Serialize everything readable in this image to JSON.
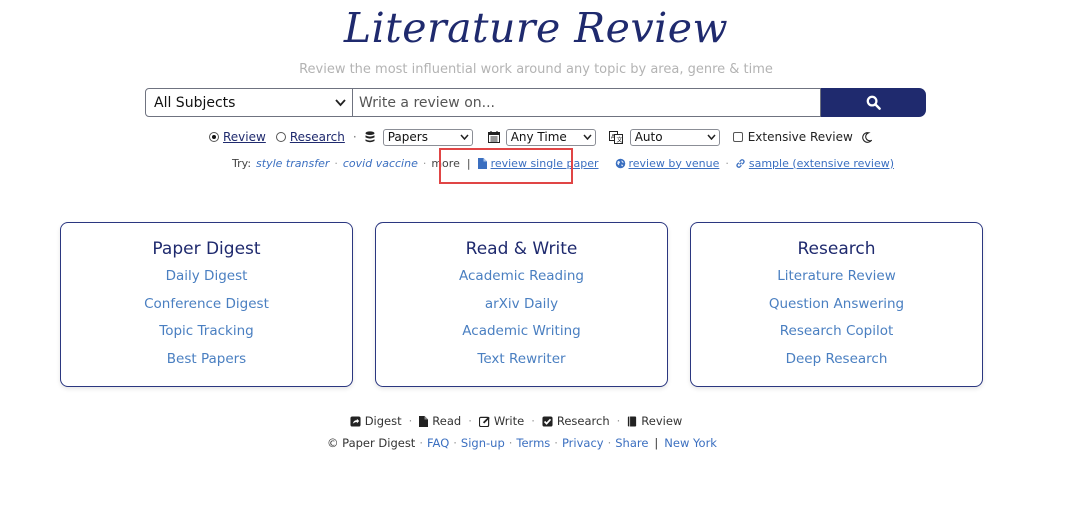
{
  "header": {
    "title": "Literature Review",
    "subtitle": "Review the most influential work around any topic by area, genre & time"
  },
  "search": {
    "subject_selected": "All Subjects",
    "placeholder": "Write a review on..."
  },
  "options": {
    "mode_review": "Review",
    "mode_research": "Research",
    "mode_selected": "Review",
    "source": "Papers",
    "time": "Any Time",
    "language": "Auto",
    "extensive_label": "Extensive Review",
    "extensive_checked": false
  },
  "try_row": {
    "label": "Try:",
    "examples": [
      "style transfer",
      "covid vaccine"
    ],
    "more": "more",
    "review_single_paper": "review single paper",
    "review_by_venue": "review by venue",
    "sample_extensive": "sample (extensive review)"
  },
  "cards": [
    {
      "title": "Paper Digest",
      "items": [
        "Daily Digest",
        "Conference Digest",
        "Topic Tracking",
        "Best Papers"
      ]
    },
    {
      "title": "Read & Write",
      "items": [
        "Academic Reading",
        "arXiv Daily",
        "Academic Writing",
        "Text Rewriter"
      ]
    },
    {
      "title": "Research",
      "items": [
        "Literature Review",
        "Question Answering",
        "Research Copilot",
        "Deep Research"
      ]
    }
  ],
  "footer": {
    "nav": [
      "Digest",
      "Read",
      "Write",
      "Research",
      "Review"
    ],
    "copyright": "© Paper Digest",
    "links": [
      "FAQ",
      "Sign-up",
      "Terms",
      "Privacy",
      "Share"
    ],
    "location": "New York"
  },
  "colors": {
    "brand_navy": "#1f2a6e",
    "link_blue": "#4a7fc1",
    "highlight_red": "#e04545"
  }
}
